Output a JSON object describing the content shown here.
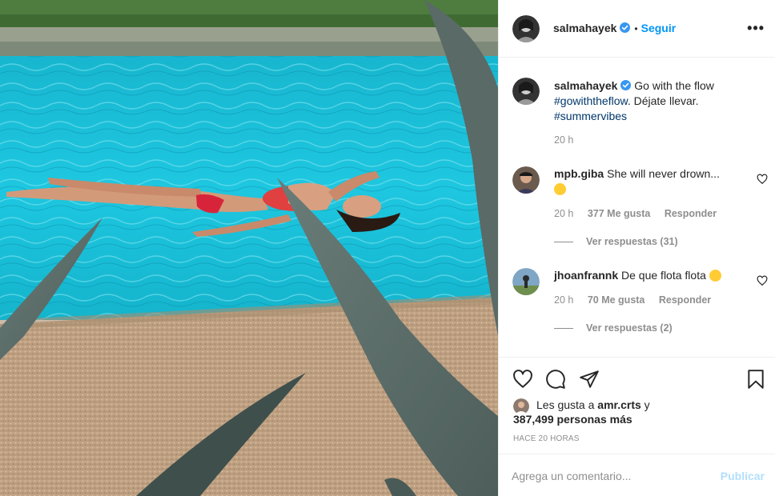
{
  "post": {
    "photo_icon": "post-photo",
    "author": {
      "username": "salmahayek",
      "verified": true,
      "follow_label": "Seguir",
      "separator": "•",
      "more_label": "•••"
    },
    "caption": {
      "username": "salmahayek",
      "text_plain": "Go with the flow",
      "hashtag_1": "#gowiththeflow",
      "text_after": ". Déjate llevar.",
      "hashtag_2": "#summervibes",
      "time": "20 h"
    },
    "comments": [
      {
        "username": "mpb.giba",
        "text": "She will never drown...",
        "emoji": "face-with-tears-of-joy",
        "time": "20 h",
        "likes": "377 Me gusta",
        "reply_label": "Responder",
        "view_replies": "Ver respuestas (31)"
      },
      {
        "username": "jhoanfrannk",
        "text": "De que flota flota",
        "emoji": "hushed-face",
        "time": "20 h",
        "likes": "70 Me gusta",
        "reply_label": "Responder",
        "view_replies": "Ver respuestas (2)"
      }
    ],
    "actions": {
      "icons": [
        "heart-icon",
        "comment-icon",
        "share-icon",
        "bookmark-icon"
      ]
    },
    "likes": {
      "line1_prefix": "Les gusta a",
      "line1_user": "amr.crts",
      "line1_suffix": "y",
      "line2": "387,499 personas más"
    },
    "timestamp": "HACE 20 HORAS",
    "comment_input": {
      "placeholder": "Agrega un comentario...",
      "publish_label": "Publicar"
    }
  },
  "colors": {
    "link": "#0095f6",
    "hashtag": "#00376b",
    "muted": "#8e8e8e",
    "publish_disabled": "#b2dffc",
    "verified": "#3897f0"
  }
}
